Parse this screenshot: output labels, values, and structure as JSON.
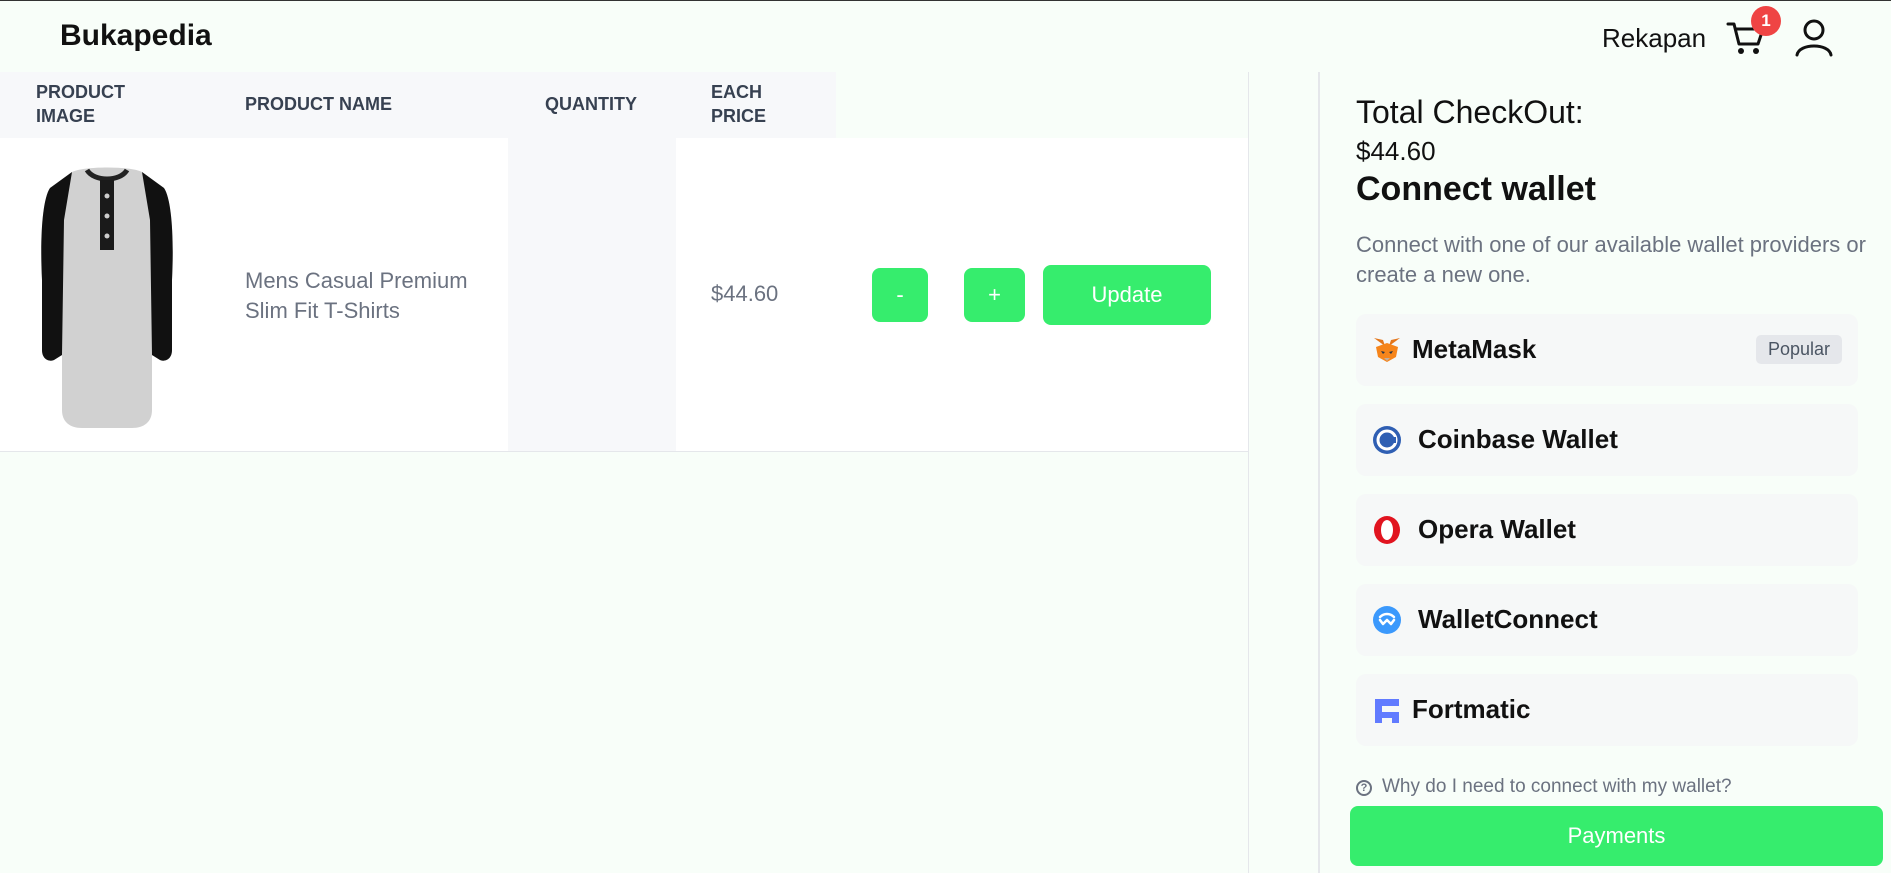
{
  "header": {
    "brand": "Bukapedia",
    "rekapan_label": "Rekapan",
    "cart_count": "1"
  },
  "table": {
    "headers": {
      "product_image": "PRODUCT IMAGE",
      "product_name": "PRODUCT NAME",
      "quantity": "QUANTITY",
      "each_price": "EACH PRICE"
    },
    "rows": [
      {
        "product_name": "Mens Casual Premium Slim Fit T-Shirts",
        "price": "$44.60",
        "minus_label": "-",
        "plus_label": "+",
        "update_label": "Update"
      }
    ]
  },
  "checkout": {
    "total_label": "Total CheckOut:",
    "total_value": "$44.60",
    "connect_title": "Connect wallet",
    "connect_desc": "Connect with one of our available wallet providers or create a new one.",
    "wallets": [
      {
        "name": "MetaMask",
        "icon": "metamask-fox-icon",
        "badge": "Popular"
      },
      {
        "name": "Coinbase Wallet",
        "icon": "coinbase-icon"
      },
      {
        "name": "Opera Wallet",
        "icon": "opera-icon"
      },
      {
        "name": "WalletConnect",
        "icon": "walletconnect-icon"
      },
      {
        "name": "Fortmatic",
        "icon": "fortmatic-icon"
      }
    ],
    "help_text": "Why do I need to connect with my wallet?",
    "payments_label": "Payments"
  },
  "colors": {
    "accent_green": "#36ed6d",
    "badge_red": "#ef4444",
    "background": "#f8fef9"
  }
}
